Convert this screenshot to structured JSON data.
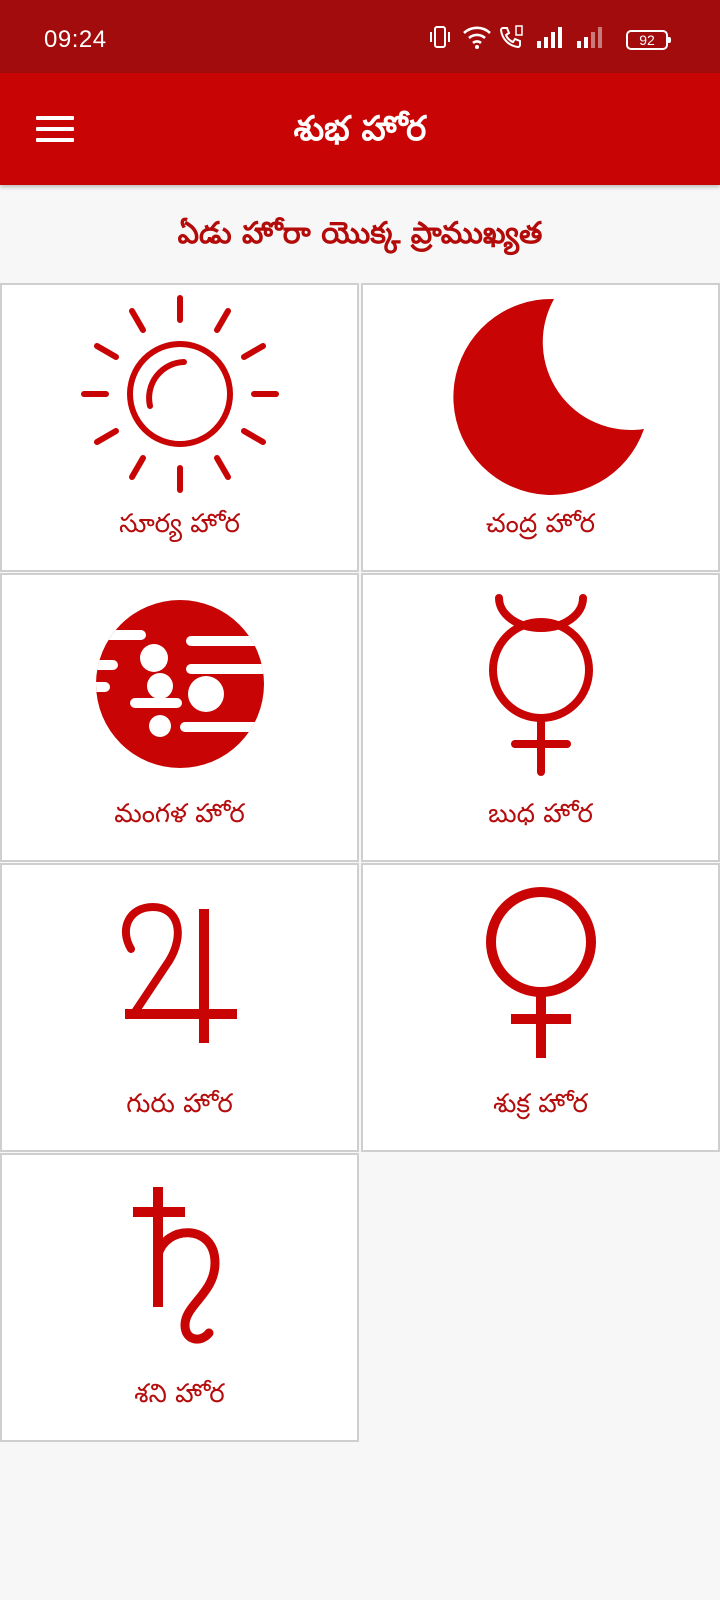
{
  "status_bar": {
    "time": "09:24",
    "battery_level": "92",
    "icons": [
      "vibrate-icon",
      "wifi-icon",
      "volte-call-icon",
      "signal-icon",
      "signal-icon-sim2",
      "battery-icon"
    ]
  },
  "app_bar": {
    "title": "శుభ హోర",
    "menu_icon": "hamburger-menu-icon"
  },
  "heading": "ఏడు హోరా యొక్క ప్రాముఖ్యత",
  "horas": [
    {
      "label": "సూర్య హోర",
      "icon": "sun-icon"
    },
    {
      "label": "చంద్ర హోర",
      "icon": "crescent-moon-icon"
    },
    {
      "label": "మంగళ హోర",
      "icon": "mars-planet-icon"
    },
    {
      "label": "బుధ హోర",
      "icon": "mercury-symbol-icon"
    },
    {
      "label": "గురు హోర",
      "icon": "jupiter-symbol-icon"
    },
    {
      "label": "శుక్ర హోర",
      "icon": "venus-symbol-icon"
    },
    {
      "label": "శని హోర",
      "icon": "saturn-symbol-icon"
    }
  ],
  "colors": {
    "status_bar": "#a20c0c",
    "app_bar": "#c80404",
    "accent": "#c80404",
    "heading_text": "#b30a0a",
    "background": "#f7f7f7"
  }
}
